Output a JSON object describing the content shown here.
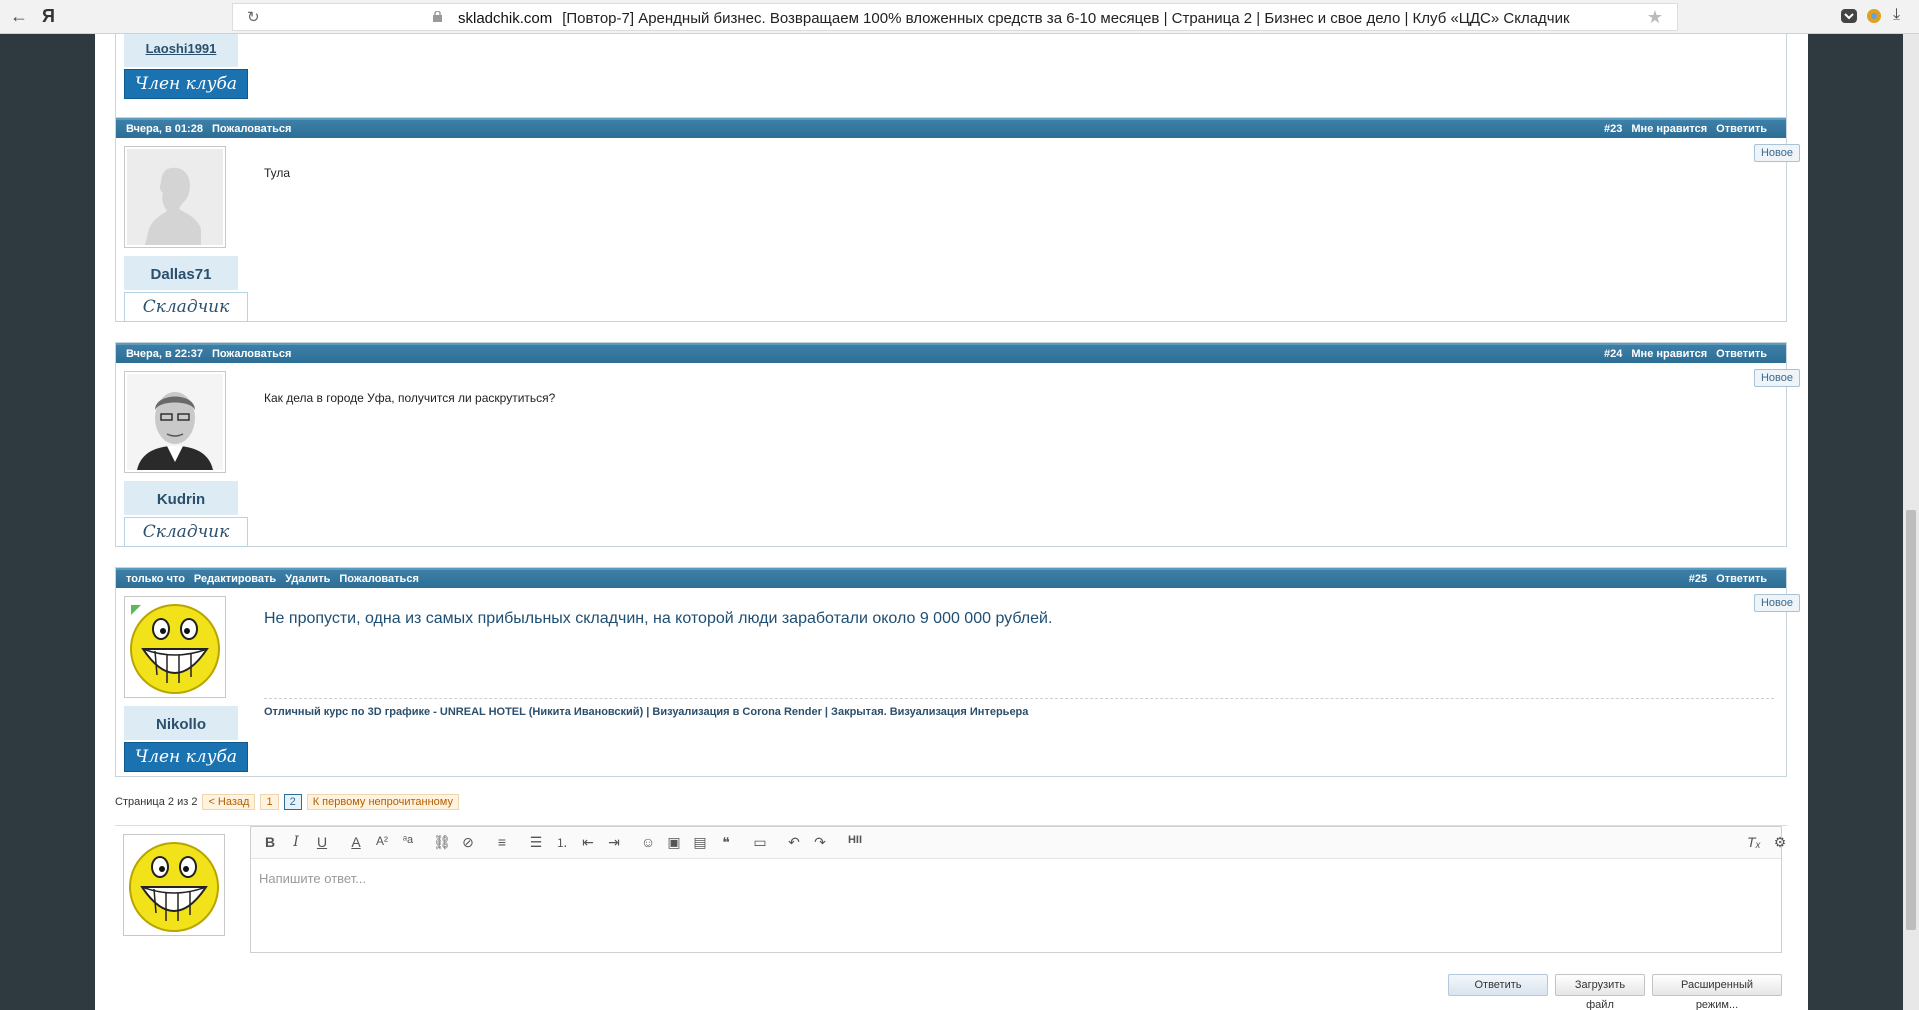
{
  "browser": {
    "logo": "Я",
    "domain": "skladchik.com",
    "title": "[Повтор-7] Арендный бизнес. Возвращаем 100% вложенных средств за 6-10 месяцев | Страница 2 | Бизнес и свое дело | Клуб «ЦДС» Складчик"
  },
  "top_user": {
    "name": "Laoshi1991",
    "rank": "Член клуба"
  },
  "posts": [
    {
      "date": "Вчера, в 01:28",
      "report": "Пожаловаться",
      "num": "#23",
      "like": "Мне нравится",
      "reply": "Ответить",
      "badge": "Новое",
      "user": "Dallas71",
      "rank": "Складчик",
      "message": "Тула"
    },
    {
      "date": "Вчера, в 22:37",
      "report": "Пожаловаться",
      "num": "#24",
      "like": "Мне нравится",
      "reply": "Ответить",
      "badge": "Новое",
      "user": "Kudrin",
      "rank": "Складчик",
      "message": "Как дела в городе Уфа, получится ли раскрутиться?"
    },
    {
      "date": "только что",
      "edit": "Редактировать",
      "delete": "Удалить",
      "report": "Пожаловаться",
      "num": "#25",
      "reply": "Ответить",
      "badge": "Новое",
      "user": "Nikollo",
      "rank": "Член клуба",
      "message": "Не пропусти, одна из самых прибыльных складчин, на которой люди заработали около 9 000 000 рублей.",
      "signature": "Отличный курс по 3D графике - UNREAL HOTEL (Никита Ивановский) | Визуализация в Corona Render | Закрытая. Визуализация Интерьера"
    }
  ],
  "pager": {
    "label": "Страница 2 из 2",
    "back": "< Назад",
    "p1": "1",
    "p2": "2",
    "first_unread": "К первому непрочитанному"
  },
  "editor": {
    "placeholder": "Напишите ответ...",
    "reply_button": "Ответить",
    "upload_button": "Загрузить файл",
    "advanced_button": "Расширенный режим..."
  },
  "colors": {
    "header_blue": "#2c6e95",
    "rank_blue": "#1a73b0",
    "username": "#2b4f6d"
  }
}
